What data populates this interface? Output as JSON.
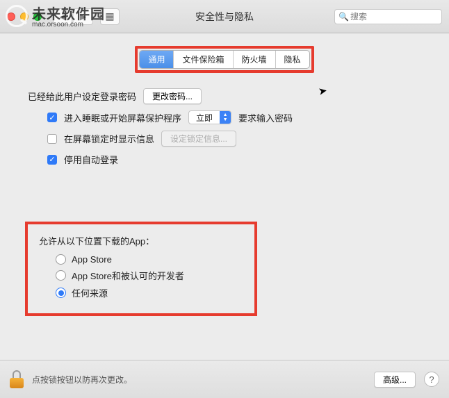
{
  "window": {
    "title": "安全性与隐私",
    "search_placeholder": "搜索"
  },
  "watermark": {
    "main": "未来软件园",
    "sub": "mac.orsoon.com"
  },
  "tabs": [
    {
      "label": "通用",
      "active": true
    },
    {
      "label": "文件保险箱",
      "active": false
    },
    {
      "label": "防火墙",
      "active": false
    },
    {
      "label": "隐私",
      "active": false
    }
  ],
  "password_section": {
    "has_password_text": "已经给此用户设定登录密码",
    "change_password_btn": "更改密码...",
    "require_password_prefix": "进入睡眠或开始屏幕保护程序",
    "require_password_select": "立即",
    "require_password_suffix": "要求输入密码",
    "show_message_label": "在屏幕锁定时显示信息",
    "set_message_btn": "设定锁定信息...",
    "disable_autologin_label": "停用自动登录"
  },
  "allow_section": {
    "title": "允许从以下位置下载的App：",
    "options": [
      {
        "label": "App Store",
        "selected": false
      },
      {
        "label": "App Store和被认可的开发者",
        "selected": false
      },
      {
        "label": "任何来源",
        "selected": true
      }
    ]
  },
  "footer": {
    "lock_text": "点按锁按钮以防再次更改。",
    "advanced_btn": "高级...",
    "help": "?"
  }
}
